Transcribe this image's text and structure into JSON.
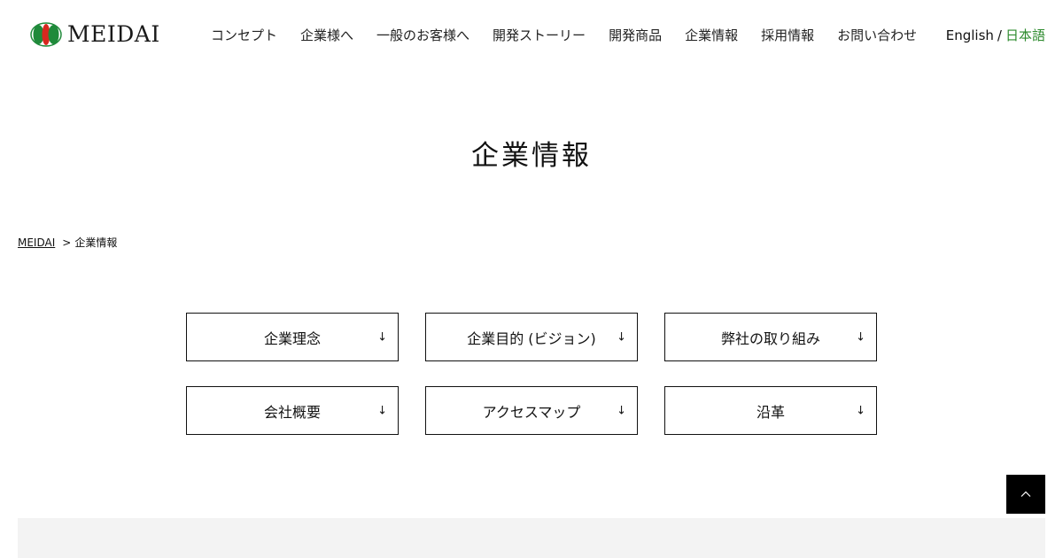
{
  "brand": {
    "name": "MEIDAI"
  },
  "nav": {
    "items": [
      {
        "label": "コンセプト"
      },
      {
        "label": "企業様へ"
      },
      {
        "label": "一般のお客様へ"
      },
      {
        "label": "開発ストーリー"
      },
      {
        "label": "開発商品"
      },
      {
        "label": "企業情報"
      },
      {
        "label": "採用情報"
      },
      {
        "label": "お問い合わせ"
      }
    ],
    "lang": {
      "english": "English",
      "separator": "/",
      "japanese": "日本語"
    }
  },
  "page": {
    "title": "企業情報"
  },
  "breadcrumb": {
    "home": "MEIDAI",
    "separator": ">",
    "current": "企業情報"
  },
  "sections": {
    "arrow": "↓",
    "buttons": [
      {
        "label": "企業理念"
      },
      {
        "label": "企業目的 (ビジョン)"
      },
      {
        "label": "弊社の取り組み"
      },
      {
        "label": "会社概要"
      },
      {
        "label": "アクセスマップ"
      },
      {
        "label": "沿革"
      }
    ]
  },
  "colors": {
    "accent_green": "#2e8b2e",
    "logo_red": "#d7281f",
    "logo_green": "#1f8a3a",
    "footer_bg": "#f3f3f3"
  },
  "icons": {
    "logo_mark": "meidai-logo-icon",
    "to_top": "chevron-up-icon",
    "section_arrow": "arrow-down-icon"
  }
}
